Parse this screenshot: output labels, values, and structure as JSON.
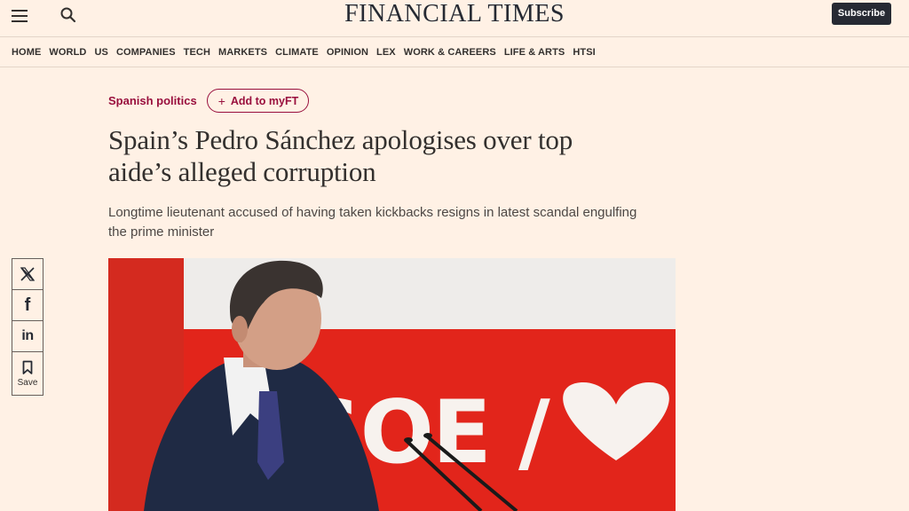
{
  "header": {
    "masthead": "FINANCIAL TIMES",
    "subscribe_label": "Subscribe",
    "menu_icon": "hamburger-menu-icon",
    "search_icon": "search-icon"
  },
  "nav": {
    "items": [
      "HOME",
      "WORLD",
      "US",
      "COMPANIES",
      "TECH",
      "MARKETS",
      "CLIMATE",
      "OPINION",
      "LEX",
      "WORK & CAREERS",
      "LIFE & ARTS",
      "HTSI"
    ]
  },
  "article": {
    "topic": "Spanish politics",
    "add_to_myft_label": "Add to myFT",
    "headline": "Spain’s Pedro Sánchez apologises over top aide’s alleged corruption",
    "standfirst": "Longtime lieutenant accused of having taken kickbacks resigns in latest scandal engulfing the prime minister",
    "image_text": "SOE /"
  },
  "share": {
    "save_label": "Save",
    "icons": [
      "x-icon",
      "facebook-icon",
      "linkedin-icon",
      "bookmark-icon"
    ]
  },
  "colors": {
    "page_bg": "#fff1e5",
    "accent": "#990f3d",
    "subscribe_bg": "#262a33",
    "photo_red": "#e2251b"
  }
}
